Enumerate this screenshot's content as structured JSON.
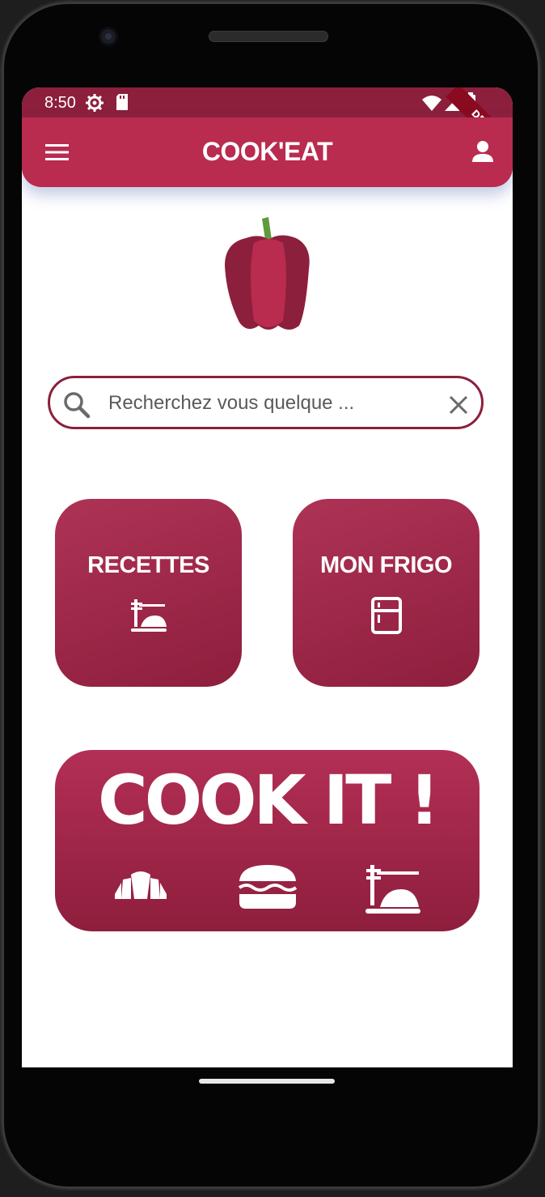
{
  "status_bar": {
    "time": "8:50",
    "debug_label": "DEBUG"
  },
  "app_bar": {
    "title": "COOK'EAT"
  },
  "search": {
    "placeholder": "Recherchez vous quelque ..."
  },
  "tiles": {
    "recettes_label": "RECETTES",
    "frigo_label": "MON FRIGO"
  },
  "cookit": {
    "label": "COOK IT !"
  },
  "colors": {
    "brand": "#b92b4f",
    "brand_dark": "#8c1f3c",
    "background": "#ffffff"
  },
  "icons": [
    "menu-icon",
    "user-icon",
    "pepper-logo",
    "search-icon",
    "clear-icon",
    "dish-icon",
    "fridge-icon",
    "croissant-icon",
    "burger-icon"
  ]
}
